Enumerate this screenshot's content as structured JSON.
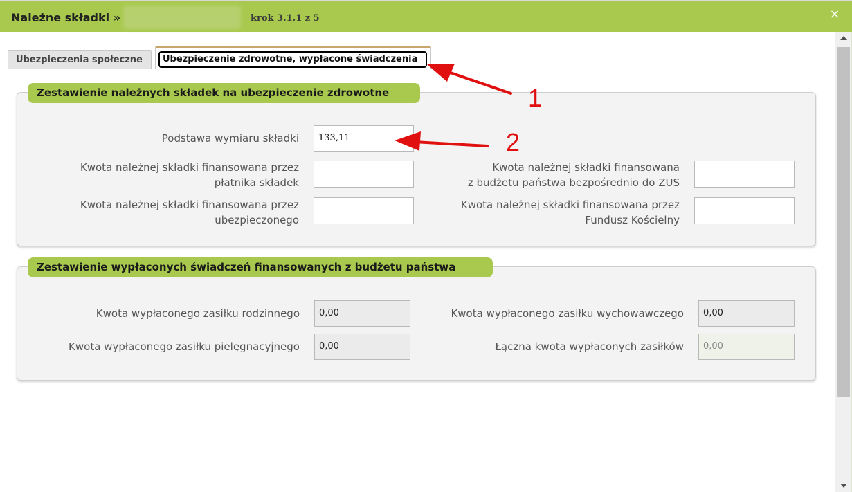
{
  "title": {
    "text": "Należne składki »",
    "step": "krok 3.1.1 z 5",
    "close_glyph": "×"
  },
  "tabs": [
    {
      "label": "Ubezpieczenia społeczne",
      "active": false
    },
    {
      "label": "Ubezpieczenie zdrowotne, wypłacone świadczenia",
      "active": true
    }
  ],
  "section1": {
    "legend": "Zestawienie należnych składek na ubezpieczenie zdrowotne",
    "fields": {
      "podstawa": {
        "label": "Podstawa wymiaru składki",
        "value": "133,11"
      },
      "platnik": {
        "label_l1": "Kwota należnej składki finansowana przez",
        "label_l2": "płatnika składek",
        "value": ""
      },
      "budzet": {
        "label_l1": "Kwota należnej składki finansowana",
        "label_l2": "z budżetu państwa bezpośrednio do ZUS",
        "value": ""
      },
      "ubezpieczony": {
        "label_l1": "Kwota należnej składki finansowana przez",
        "label_l2": "ubezpieczonego",
        "value": ""
      },
      "fundusz": {
        "label_l1": "Kwota należnej składki finansowana przez",
        "label_l2": "Fundusz Kościelny",
        "value": ""
      }
    }
  },
  "section2": {
    "legend": "Zestawienie wypłaconych świadczeń finansowanych z budżetu państwa",
    "fields": {
      "rodzinny": {
        "label": "Kwota wypłaconego zasiłku rodzinnego",
        "value": "0,00"
      },
      "wychowawczy": {
        "label": "Kwota wypłaconego zasiłku wychowawczego",
        "value": "0,00"
      },
      "pielegnacyjny": {
        "label": "Kwota wypłaconego zasiłku pielęgnacyjnego",
        "value": "0,00"
      },
      "laczna": {
        "label": "Łączna kwota wypłaconych zasiłków",
        "value": "0,00"
      }
    }
  },
  "annotations": {
    "one": "1",
    "two": "2",
    "color": "#e01010"
  },
  "colors": {
    "accent": "#a8c94e",
    "panel": "#f3f3f3",
    "tab_active_top": "#c9a66b"
  }
}
